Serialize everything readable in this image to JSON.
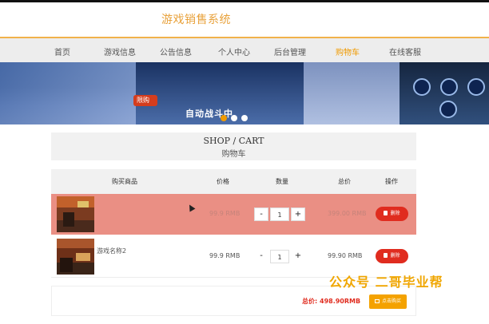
{
  "header": {
    "brand": "游戏销售系统"
  },
  "nav": {
    "items": [
      {
        "label": "首页"
      },
      {
        "label": "游戏信息"
      },
      {
        "label": "公告信息"
      },
      {
        "label": "个人中心"
      },
      {
        "label": "后台管理"
      },
      {
        "label": "购物车",
        "active": true
      },
      {
        "label": "在线客服"
      }
    ],
    "active_color": "#f09a00"
  },
  "banner": {
    "caption": "自动战斗中",
    "badge": "限购",
    "carousel_active_index": 0,
    "dot_count": 3
  },
  "page_title": {
    "en": "SHOP / CART",
    "cn": "购物车"
  },
  "table": {
    "headers": [
      "购买商品",
      "价格",
      "数量",
      "总价",
      "操作"
    ],
    "rows": [
      {
        "name": "",
        "price": "99.9 RMB",
        "qty": "1",
        "total": "399.00 RMB",
        "action": "删除",
        "highlighted": true
      },
      {
        "name": "游戏名称2",
        "price": "99.9 RMB",
        "qty": "1",
        "total": "99.90 RMB",
        "action": "删除",
        "highlighted": false
      }
    ],
    "minus_label": "-",
    "plus_label": "+"
  },
  "summary": {
    "total_label": "总价:",
    "total_value": "498.90RMB",
    "pay_label": "点击购买"
  },
  "watermark": "公众号  二哥毕业帮",
  "colors": {
    "accent": "#f4a200",
    "danger": "#e02c1f",
    "row_highlight": "#ea8f84"
  }
}
